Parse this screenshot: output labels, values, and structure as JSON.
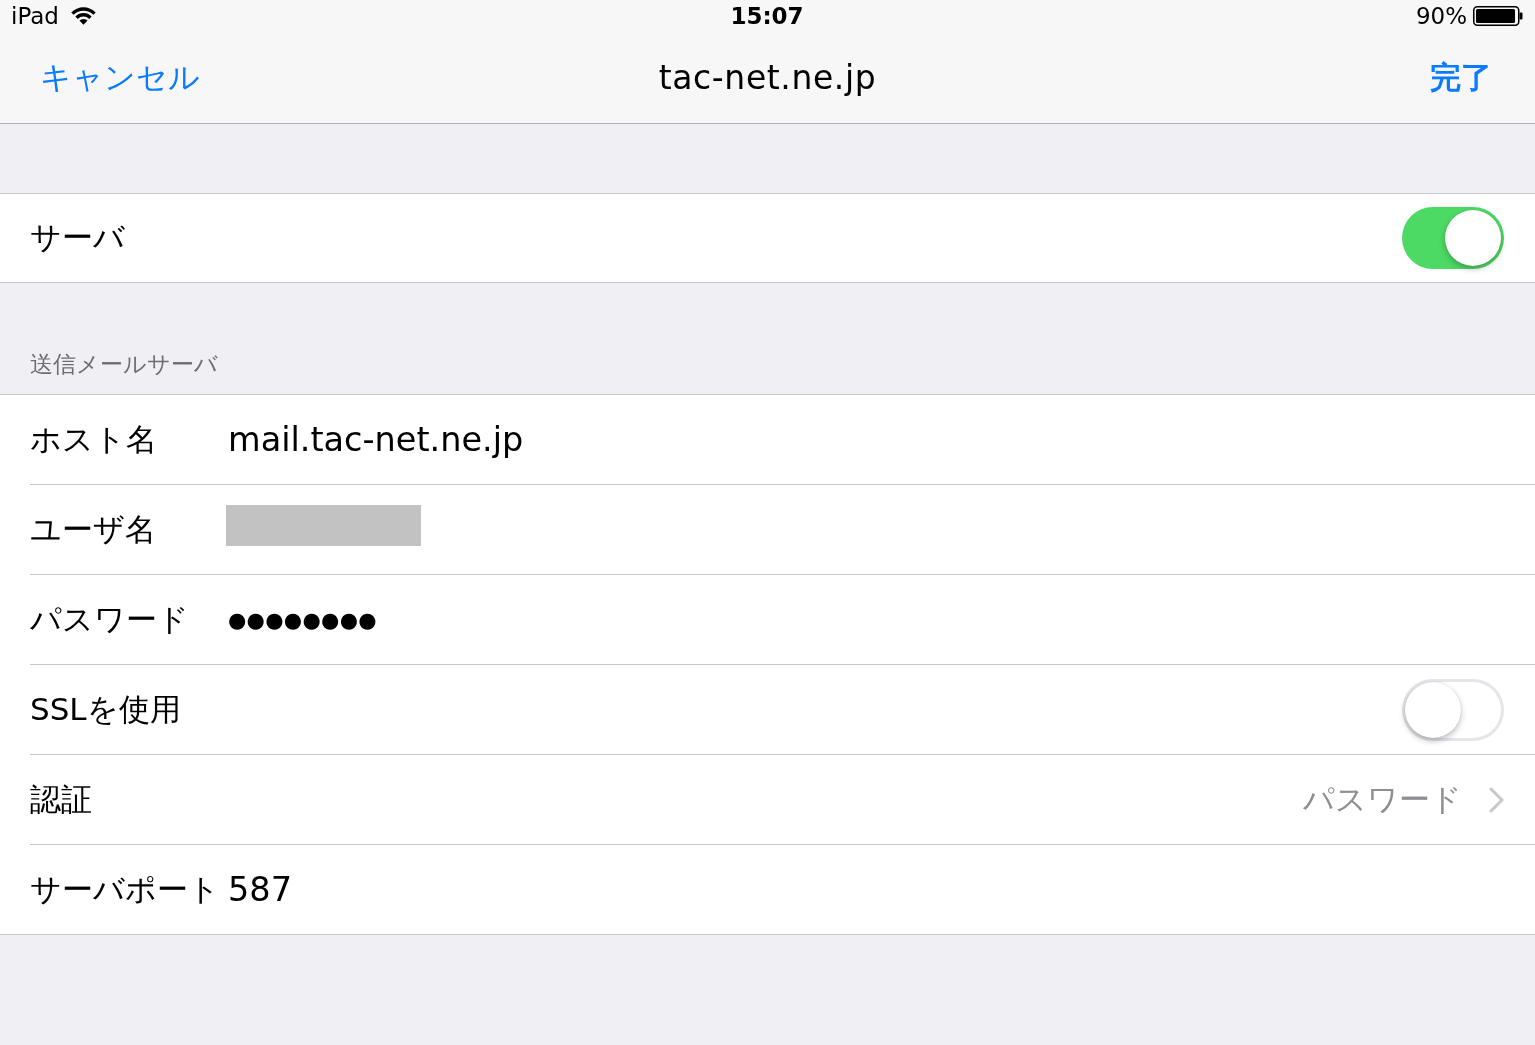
{
  "status_bar": {
    "device": "iPad",
    "time": "15:07",
    "battery": "90%"
  },
  "nav_bar": {
    "cancel": "キャンセル",
    "title": "tac-net.ne.jp",
    "done": "完了"
  },
  "groups": [
    {
      "rows": [
        {
          "kind": "toggle",
          "label": "サーバ",
          "on": true
        }
      ]
    },
    {
      "header": "送信メールサーバ",
      "rows": [
        {
          "kind": "text",
          "label": "ホスト名",
          "value": "mail.tac-net.ne.jp"
        },
        {
          "kind": "redacted",
          "label": "ユーザ名"
        },
        {
          "kind": "password",
          "label": "パスワード",
          "value": "●●●●●●●●"
        },
        {
          "kind": "toggle",
          "label": "SSLを使用",
          "on": false
        },
        {
          "kind": "disclosure",
          "label": "認証",
          "value": "パスワード"
        },
        {
          "kind": "text",
          "label": "サーバポート",
          "value": "587"
        }
      ]
    }
  ]
}
